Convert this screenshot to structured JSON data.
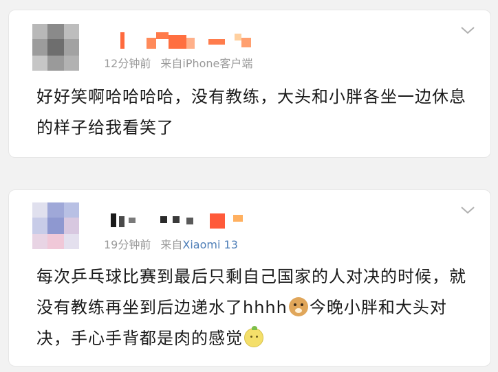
{
  "posts": [
    {
      "time": "12分钟前",
      "source": "来自iPhone客户端",
      "text": "好好笑啊哈哈哈哈，没有教练，大头和小胖各坐一边休息的样子给我看笑了",
      "avatar_icon": "blurred-avatar",
      "name_icon": "blurred-username"
    },
    {
      "time": "19分钟前",
      "source_prefix": "来自",
      "source_device": "Xiaomi 13",
      "device_color": "#4f7fb8",
      "text_part1": "每次乒乓球比赛到最后只剩自己国家的人对决的时候，就没有教练再坐到后边递水了hhhh",
      "emoji1": "doge-emoji",
      "text_part2": "今晚小胖和大头对决，手心手背都是肉的感觉",
      "emoji2": "lemon-emoji",
      "avatar_icon": "blurred-avatar",
      "name_icon": "blurred-username"
    }
  ],
  "menu_icon": "chevron-down-icon",
  "colors": {
    "background": "#f2f2f2",
    "card": "#ffffff",
    "meta": "#9a9a9a",
    "text": "#1a1a1a"
  }
}
